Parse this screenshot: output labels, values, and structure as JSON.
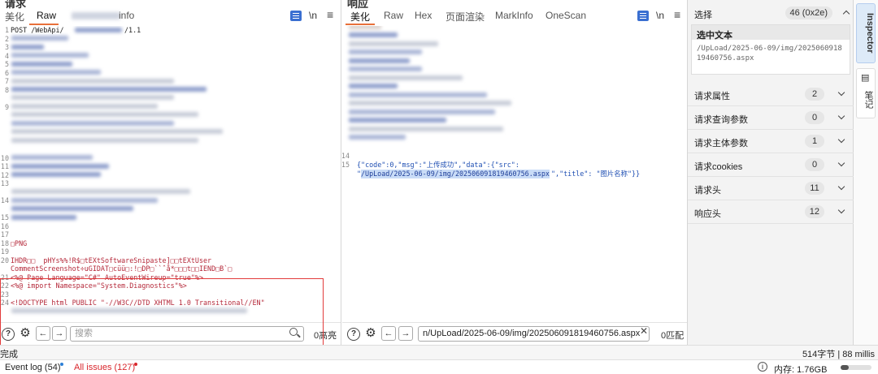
{
  "request": {
    "title": "请求",
    "tabs": [
      "美化",
      "Raw",
      "info"
    ],
    "line1": "POST /WebApi/",
    "line1_end": "/1.1",
    "line_png": "PNG",
    "line_ihdr": "IHDR□□  pHYs%%!R$□tEXtSoftwareSnipaste]□□tEXtUser",
    "line_comment": "CommentScreenshot÷uGIDAT□cüü□:!□DP□``ˆå*□□□t□□IEND□B`□",
    "line_page": "<%@ Page Language=\"C#\" AutoEventWireup=\"true\"%>",
    "line_import": "<%@ import Namespace=\"System.Diagnostics\"%>",
    "line_doctype": "<!DOCTYPE html PUBLIC \"-//W3C//DTD XHTML 1.0 Transitional//EN\"",
    "search_placeholder": "搜索",
    "search_count": "0高亮"
  },
  "response": {
    "title": "响应",
    "tabs": [
      "美化",
      "Raw",
      "Hex",
      "页面渲染",
      "MarkInfo",
      "OneScan"
    ],
    "line15a": "{\"code\":0,\"msg\":\"上传成功\",\"data\":{\"src\":",
    "line15_quote": "\"",
    "line15_path": "/UpLoad/2025-06-09/img/202506091819460756.aspx",
    "line15_rest": "\",\"title\": \"图片名称\"}}",
    "search_value": "n/UpLoad/2025-06-09/img/202506091819460756.aspx",
    "search_count": "0匹配"
  },
  "toolbar": {
    "newline_label": "\\n",
    "menu_label": "≡"
  },
  "inspector": {
    "selection_label": "选择",
    "selection_count": "46 (0x2e)",
    "selected_text_header": "选中文本",
    "selected_text": "/UpLoad/2025-06-09/img/202506091819460756.aspx",
    "rows": [
      {
        "label": "请求属性",
        "count": "2"
      },
      {
        "label": "请求查询参数",
        "count": "0"
      },
      {
        "label": "请求主体参数",
        "count": "1"
      },
      {
        "label": "请求cookies",
        "count": "0"
      },
      {
        "label": "请求头",
        "count": "11"
      },
      {
        "label": "响应头",
        "count": "12"
      }
    ]
  },
  "side_tabs": [
    "Inspector",
    "笔记"
  ],
  "status": {
    "left": "完成",
    "right": "514字节 | 88 millis"
  },
  "footer": {
    "event_log": "Event log (54)",
    "issues": "All issues (127)",
    "memory": "内存: 1.76GB"
  },
  "colors": {
    "accent": "#e8703a",
    "issues": "#d9262c",
    "highlight_box": "#e23b3b",
    "selection": "#c9dcf7"
  }
}
